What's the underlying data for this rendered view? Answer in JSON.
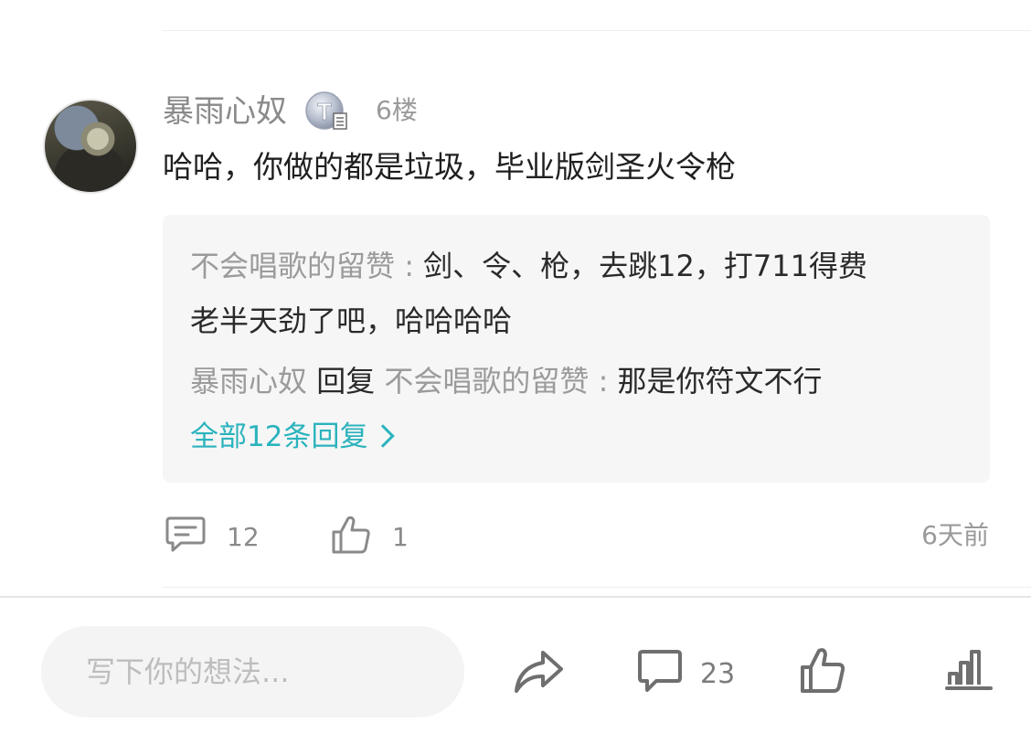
{
  "comment": {
    "username": "暴雨心奴",
    "badge_letter": "T",
    "floor": "6楼",
    "text": "哈哈，你做的都是垃圾，毕业版剑圣火令枪",
    "replies": [
      {
        "author": "不会唱歌的留赞",
        "separator": " : ",
        "text_line1": "剑、令、枪，去跳12，打711得费",
        "text_line2": "老半天劲了吧，哈哈哈哈"
      },
      {
        "author": "暴雨心奴",
        "reply_word": " 回复 ",
        "target": "不会唱歌的留赞",
        "separator": " : ",
        "text": "那是你符文不行"
      }
    ],
    "all_replies_label": "全部12条回复",
    "comment_count": "12",
    "like_count": "1",
    "time": "6天前"
  },
  "bottom_bar": {
    "input_placeholder": "写下你的想法...",
    "comment_count": "23",
    "icons": [
      "share-icon",
      "comment-icon",
      "like-icon",
      "stats-icon"
    ]
  },
  "colors": {
    "accent": "#2bb3bd",
    "reply_bg": "#f6f6f6",
    "secondary_text": "#9b9b9b"
  }
}
